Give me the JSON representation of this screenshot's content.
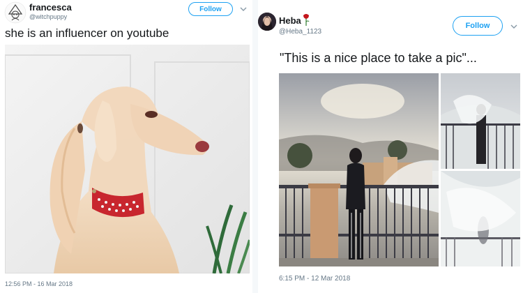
{
  "tweets": [
    {
      "display_name": "francesca",
      "handle": "@witchpuppy",
      "follow_label": "Follow",
      "text": "she is an influencer on youtube",
      "timestamp": "12:56 PM - 16 Mar 2018",
      "media_icon": "afghan-hound-photo",
      "avatar_icon": "anime-sketch-avatar"
    },
    {
      "display_name": "Heba",
      "name_emoji": "rose",
      "handle": "@Heba_1123",
      "follow_label": "Follow",
      "text": "\"This is a nice place to take a pic\"...",
      "timestamp": "6:15 PM - 12 Mar 2018",
      "media_icon": "wave-splash-photo-grid",
      "avatar_icon": "profile-photo-avatar"
    }
  ],
  "colors": {
    "accent": "#1da1f2",
    "text": "#14171a",
    "secondary_text": "#657786"
  }
}
